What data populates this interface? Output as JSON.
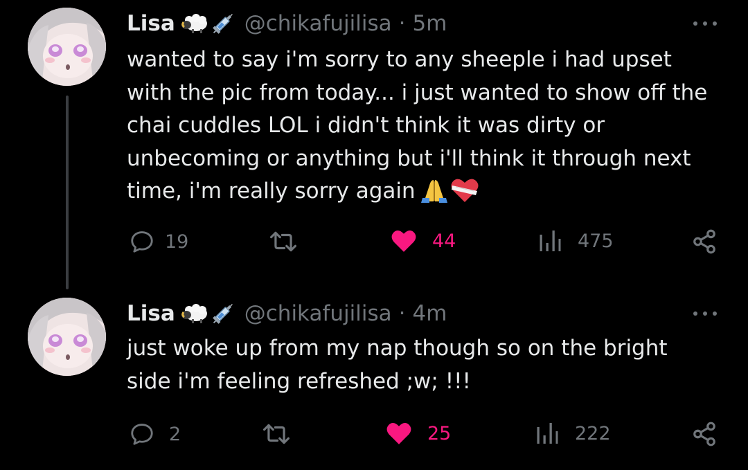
{
  "colors": {
    "background": "#000000",
    "text": "#e7e9ea",
    "muted": "#71767b",
    "like": "#f91880"
  },
  "tweets": [
    {
      "name": "Lisa",
      "badges": [
        "sheep-emoji",
        "syringe-emoji"
      ],
      "handle": "@chikafujilisa",
      "separator": "·",
      "time": "5m",
      "lines": [
        "wanted to say i'm sorry to any sheeple i had upset",
        "with the pic from today... i just wanted to show off the",
        "chai cuddles LOL i didn't think it was dirty or",
        "unbecoming or anything but i'll think it through next",
        "time, i'm really sorry again"
      ],
      "trailing_emojis": [
        "folded-hands-emoji",
        "mending-heart-emoji"
      ],
      "replies": "19",
      "likes": "44",
      "views": "475"
    },
    {
      "name": "Lisa",
      "badges": [
        "sheep-emoji",
        "syringe-emoji"
      ],
      "handle": "@chikafujilisa",
      "separator": "·",
      "time": "4m",
      "lines": [
        "just woke up from my nap though so on the bright",
        "side i'm feeling refreshed ;w; !!!"
      ],
      "replies": "2",
      "likes": "25",
      "views": "222"
    }
  ]
}
